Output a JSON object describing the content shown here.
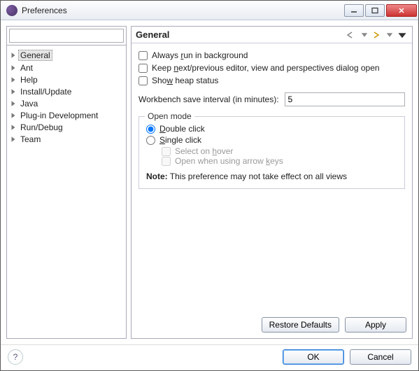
{
  "window": {
    "title": "Preferences"
  },
  "filter": {
    "placeholder": ""
  },
  "tree": {
    "items": [
      {
        "label": "General",
        "selected": true
      },
      {
        "label": "Ant"
      },
      {
        "label": "Help"
      },
      {
        "label": "Install/Update"
      },
      {
        "label": "Java"
      },
      {
        "label": "Plug-in Development"
      },
      {
        "label": "Run/Debug"
      },
      {
        "label": "Team"
      }
    ]
  },
  "page": {
    "heading": "General",
    "always_bg": {
      "label_pre": "Always ",
      "u": "r",
      "label_post": "un in background",
      "checked": false
    },
    "keep_editor": {
      "label_pre": "Keep ",
      "u": "n",
      "label_post": "ext/previous editor, view and perspectives dialog open",
      "checked": false
    },
    "heap": {
      "label_pre": "Sho",
      "u": "w",
      "label_post": " heap status",
      "checked": false
    },
    "save_interval": {
      "label": "Workbench save interval (in minutes):",
      "value": "5"
    },
    "open_mode": {
      "legend": "Open mode",
      "double": {
        "u": "D",
        "post": "ouble click",
        "checked": true
      },
      "single": {
        "u": "S",
        "post": "ingle click",
        "checked": false
      },
      "hover": {
        "label_pre": "Select on ",
        "u": "h",
        "label_post": "over",
        "checked": false,
        "disabled": true
      },
      "arrows": {
        "label_pre": "Open when using arrow ",
        "u": "k",
        "label_post": "eys",
        "checked": false,
        "disabled": true
      }
    },
    "note_label": "Note:",
    "note_text": " This preference may not take effect on all views"
  },
  "buttons": {
    "restore": "Restore Defaults",
    "apply": "Apply",
    "ok": "OK",
    "cancel": "Cancel"
  }
}
